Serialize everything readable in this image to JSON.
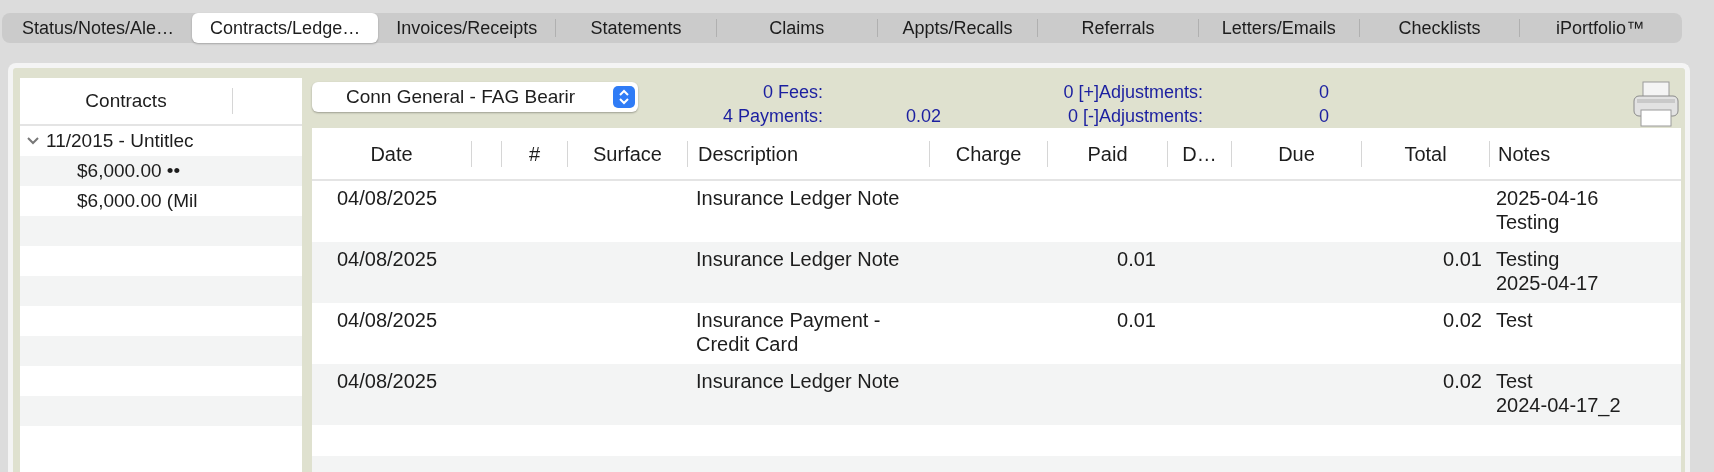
{
  "tabs": [
    {
      "label": "Status/Notes/Ale…",
      "selected": false
    },
    {
      "label": "Contracts/Ledge…",
      "selected": true
    },
    {
      "label": "Invoices/Receipts",
      "selected": false
    },
    {
      "label": "Statements",
      "selected": false
    },
    {
      "label": "Claims",
      "selected": false
    },
    {
      "label": "Appts/Recalls",
      "selected": false
    },
    {
      "label": "Referrals",
      "selected": false
    },
    {
      "label": "Letters/Emails",
      "selected": false
    },
    {
      "label": "Checklists",
      "selected": false
    },
    {
      "label": "iPortfolio™",
      "selected": false
    }
  ],
  "contracts": {
    "header": "Contracts",
    "tree": [
      {
        "label": "11/2015 - Untitlec",
        "expanded": true,
        "children": [
          {
            "label": "$6,000.00 ••"
          },
          {
            "label": "$6,000.00 (Mil"
          }
        ]
      }
    ]
  },
  "payer_select": {
    "value": "Conn General - FAG Bearir"
  },
  "summary": [
    {
      "label": "0 Fees:",
      "adj_label": "0 [+]Adjustments:",
      "adj_value": "0"
    },
    {
      "label": "4 Payments:",
      "amount": "0.02",
      "adj_label": "0 [-]Adjustments:",
      "adj_value": "0"
    }
  ],
  "table": {
    "columns": [
      {
        "label": "Date"
      },
      {},
      {
        "label": "#"
      },
      {
        "label": "Surface"
      },
      {
        "label": "Description"
      },
      {
        "label": "Charge"
      },
      {
        "label": "Paid"
      },
      {
        "label": "D…"
      },
      {
        "label": "Due"
      },
      {
        "label": "Total"
      },
      {
        "label": "Notes"
      }
    ],
    "rows": [
      {
        "date": "04/08/2025",
        "description": "Insurance Ledger Note",
        "notes": [
          "2025-04-16",
          "Testing"
        ]
      },
      {
        "date": "04/08/2025",
        "description": "Insurance Ledger Note",
        "paid": "0.01",
        "total": "0.01",
        "notes": [
          "Testing",
          "2025-04-17"
        ]
      },
      {
        "date": "04/08/2025",
        "description": "Insurance Payment - Credit Card",
        "paid": "0.01",
        "total": "0.02",
        "notes": [
          "Test"
        ]
      },
      {
        "date": "04/08/2025",
        "description": "Insurance Ledger Note",
        "total": "0.02",
        "notes": [
          "Test",
          "2024-04-17_2"
        ]
      }
    ]
  }
}
